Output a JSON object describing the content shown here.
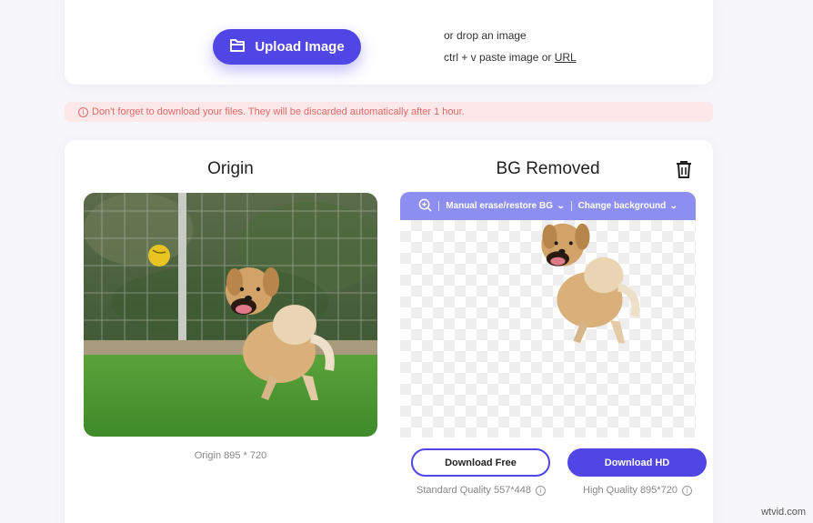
{
  "upload": {
    "button_label": "Upload Image",
    "drop_text": "or drop an image",
    "paste_prefix": "ctrl + v paste image or ",
    "url_link": "URL"
  },
  "warning": {
    "text": "Don't forget to download your files. They will be discarded automatically after 1 hour."
  },
  "origin": {
    "title": "Origin",
    "caption": "Origin 895 * 720"
  },
  "result": {
    "title": "BG Removed",
    "toolbar": {
      "erase_label": "Manual erase/restore BG",
      "change_label": "Change background"
    }
  },
  "downloads": {
    "free_label": "Download Free",
    "hd_label": "Download HD",
    "standard_quality": "Standard Quality 557*448",
    "high_quality": "High Quality 895*720"
  },
  "watermark": "wtvid.com",
  "colors": {
    "accent": "#4f46e5",
    "toolbar": "#8c8ff0",
    "warning_bg": "#fce7e9",
    "warning_text": "#e06a6a"
  }
}
